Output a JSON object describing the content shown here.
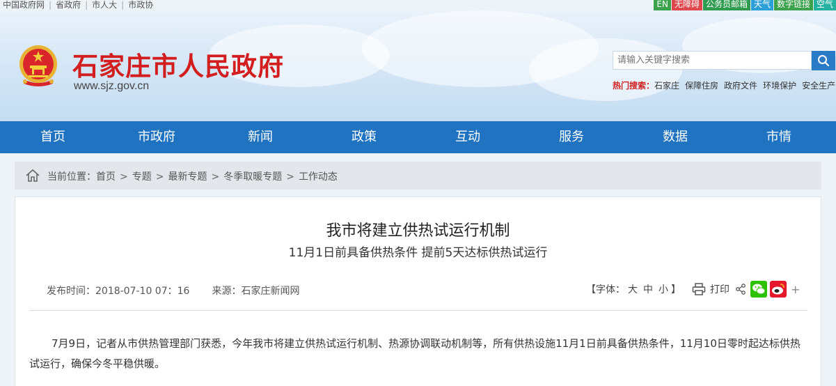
{
  "top_links": [
    "中国政府网",
    "省政府",
    "市人大",
    "市政协"
  ],
  "quick_links": [
    {
      "label": "EN",
      "color": "#3aa24a"
    },
    {
      "label": "无障碍",
      "color": "#e0474c"
    },
    {
      "label": "公务员邮箱",
      "color": "#2e9b4e"
    },
    {
      "label": "天气",
      "color": "#2a9fd8"
    },
    {
      "label": "数字链接",
      "color": "#3aa24a"
    },
    {
      "label": "空气",
      "color": "#25b0a0"
    }
  ],
  "header": {
    "site_title": "石家庄市人民政府",
    "site_url": "www.sjz.gov.cn",
    "search_placeholder": "请输入关键字搜索",
    "hot_label": "热门搜索：",
    "hot_keywords": [
      "石家庄",
      "保障住房",
      "政府文件",
      "环境保护",
      "安全生产"
    ]
  },
  "nav": [
    "首页",
    "市政府",
    "新闻",
    "政策",
    "互动",
    "服务",
    "数据",
    "市情"
  ],
  "breadcrumb": {
    "prefix": "当前位置：",
    "items": [
      "首页",
      "专题",
      "最新专题",
      "冬季取暖专题",
      "工作动态"
    ]
  },
  "article": {
    "title": "我市将建立供热试运行机制",
    "subtitle": "11月1日前具备供热条件 提前5天达标供热试运行",
    "publish_label": "发布时间：",
    "publish_time": "2018-07-10 07：16",
    "source_label": "来源：",
    "source": "石家庄新闻网",
    "font_label": "【字体：",
    "font_large": "大",
    "font_medium": "中",
    "font_small": "小",
    "font_end": "】",
    "print_label": "打印",
    "body": "7月9日，记者从市供热管理部门获悉，今年我市将建立供热试运行机制、热源协调联动机制等，所有供热设施11月1日前具备供热条件，11月10日零时起达标供热试运行，确保今冬平稳供暖。"
  },
  "colors": {
    "brand_red": "#d21e1e",
    "nav_blue": "#1f73c1"
  }
}
